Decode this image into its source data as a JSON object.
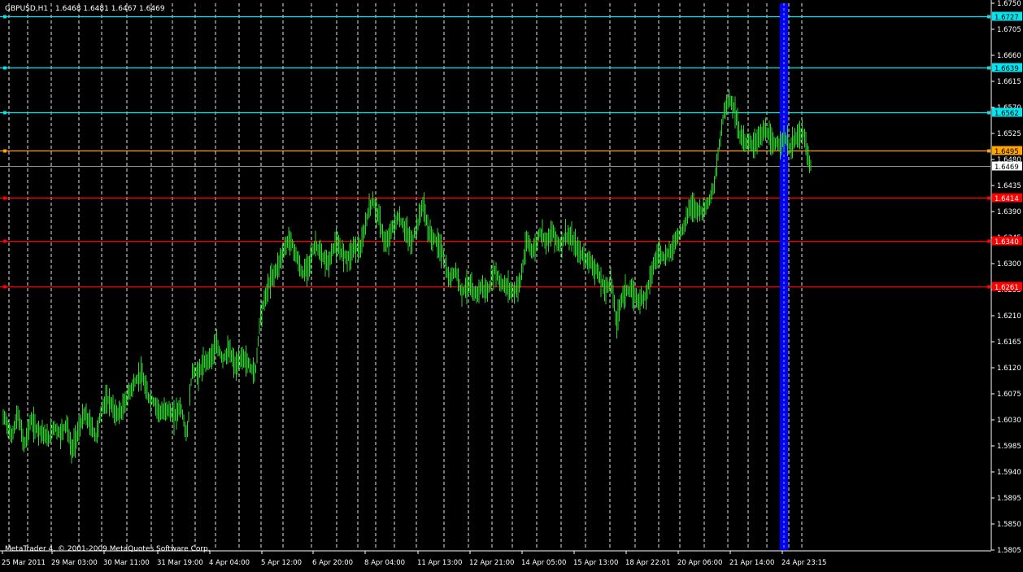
{
  "chart_data": {
    "type": "candlestick",
    "symbol_label": "GBPUSD,H1",
    "ohlc_label": "1.6468 1.6481 1.6467 1.6469",
    "copyright": "MetaTrader 4, © 2001-2009 MetaQuotes Software Corp.",
    "ylim": [
      1.5805,
      1.675
    ],
    "y_ticks": [
      "1.6750",
      "1.6705",
      "1.6660",
      "1.6615",
      "1.6570",
      "1.6525",
      "1.6480",
      "1.6435",
      "1.6390",
      "1.6345",
      "1.6300",
      "1.6255",
      "1.6210",
      "1.6165",
      "1.6120",
      "1.6075",
      "1.6030",
      "1.5985",
      "1.5940",
      "1.5895",
      "1.5850",
      "1.5805"
    ],
    "x_ticks": [
      "25 Mar 2011",
      "29 Mar 03:00",
      "30 Mar 11:00",
      "31 Mar 19:00",
      "4 Apr 04:00",
      "5 Apr 12:00",
      "6 Apr 20:00",
      "8 Apr 04:00",
      "11 Apr 13:00",
      "12 Apr 21:00",
      "14 Apr 05:00",
      "15 Apr 13:00",
      "18 Apr 22:01",
      "20 Apr 06:00",
      "21 Apr 14:00",
      "24 Apr 23:15"
    ],
    "horizontal_levels": [
      {
        "label": "1.6727",
        "value": 1.6727,
        "color": "#00e5ee",
        "tag_text_color": "#000000"
      },
      {
        "label": "1.6639",
        "value": 1.6639,
        "color": "#00e5ee",
        "tag_text_color": "#000000"
      },
      {
        "label": "1.6562",
        "value": 1.6562,
        "color": "#00e5ee",
        "tag_text_color": "#000000"
      },
      {
        "label": "1.6495",
        "value": 1.6495,
        "color": "#ffa500",
        "tag_text_color": "#000000"
      },
      {
        "label": "1.6414",
        "value": 1.6414,
        "color": "#ff0000",
        "tag_text_color": "#ffffff"
      },
      {
        "label": "1.6340",
        "value": 1.634,
        "color": "#ff0000",
        "tag_text_color": "#ffffff"
      },
      {
        "label": "1.6261",
        "value": 1.6261,
        "color": "#ff0000",
        "tag_text_color": "#ffffff"
      }
    ],
    "bid_line": {
      "label": "1.6469",
      "value": 1.6469,
      "color": "#c0c0c0"
    },
    "vertical_marker": {
      "color": "#0000ff",
      "position": "at 24 Apr 23:15"
    },
    "series_anchors": [
      [
        0,
        1.6025
      ],
      [
        6,
        1.6035
      ],
      [
        14,
        1.6
      ],
      [
        22,
        1.604
      ],
      [
        30,
        1.5985
      ],
      [
        38,
        1.603
      ],
      [
        44,
        1.6015
      ],
      [
        52,
        1.601
      ],
      [
        60,
        1.5995
      ],
      [
        66,
        1.602
      ],
      [
        74,
        1.6005
      ],
      [
        82,
        1.6025
      ],
      [
        88,
        1.5975
      ],
      [
        96,
        1.601
      ],
      [
        104,
        1.604
      ],
      [
        112,
        1.602
      ],
      [
        118,
        1.6
      ],
      [
        126,
        1.6055
      ],
      [
        134,
        1.6065
      ],
      [
        142,
        1.604
      ],
      [
        150,
        1.6045
      ],
      [
        158,
        1.6075
      ],
      [
        166,
        1.6095
      ],
      [
        174,
        1.611
      ],
      [
        182,
        1.607
      ],
      [
        190,
        1.606
      ],
      [
        198,
        1.604
      ],
      [
        206,
        1.605
      ],
      [
        214,
        1.6035
      ],
      [
        222,
        1.6055
      ],
      [
        230,
        1.6
      ],
      [
        236,
        1.6115
      ],
      [
        244,
        1.611
      ],
      [
        252,
        1.613
      ],
      [
        260,
        1.614
      ],
      [
        266,
        1.616
      ],
      [
        274,
        1.6135
      ],
      [
        282,
        1.615
      ],
      [
        290,
        1.612
      ],
      [
        298,
        1.614
      ],
      [
        306,
        1.6125
      ],
      [
        314,
        1.611
      ],
      [
        320,
        1.621
      ],
      [
        326,
        1.624
      ],
      [
        332,
        1.627
      ],
      [
        340,
        1.629
      ],
      [
        348,
        1.632
      ],
      [
        356,
        1.6345
      ],
      [
        364,
        1.6315
      ],
      [
        372,
        1.628
      ],
      [
        380,
        1.63
      ],
      [
        388,
        1.6335
      ],
      [
        396,
        1.631
      ],
      [
        404,
        1.63
      ],
      [
        412,
        1.6335
      ],
      [
        420,
        1.632
      ],
      [
        428,
        1.631
      ],
      [
        436,
        1.633
      ],
      [
        444,
        1.6325
      ],
      [
        452,
        1.6385
      ],
      [
        458,
        1.641
      ],
      [
        466,
        1.638
      ],
      [
        474,
        1.633
      ],
      [
        482,
        1.636
      ],
      [
        490,
        1.638
      ],
      [
        498,
        1.636
      ],
      [
        506,
        1.6335
      ],
      [
        514,
        1.637
      ],
      [
        520,
        1.6405
      ],
      [
        528,
        1.635
      ],
      [
        536,
        1.634
      ],
      [
        544,
        1.632
      ],
      [
        552,
        1.627
      ],
      [
        560,
        1.629
      ],
      [
        568,
        1.625
      ],
      [
        576,
        1.6265
      ],
      [
        584,
        1.6245
      ],
      [
        592,
        1.626
      ],
      [
        600,
        1.625
      ],
      [
        608,
        1.629
      ],
      [
        616,
        1.6265
      ],
      [
        624,
        1.626
      ],
      [
        632,
        1.625
      ],
      [
        640,
        1.627
      ],
      [
        648,
        1.634
      ],
      [
        656,
        1.632
      ],
      [
        664,
        1.6355
      ],
      [
        672,
        1.634
      ],
      [
        680,
        1.6355
      ],
      [
        688,
        1.633
      ],
      [
        696,
        1.635
      ],
      [
        704,
        1.634
      ],
      [
        712,
        1.632
      ],
      [
        720,
        1.631
      ],
      [
        728,
        1.63
      ],
      [
        736,
        1.628
      ],
      [
        744,
        1.6255
      ],
      [
        752,
        1.627
      ],
      [
        758,
        1.6195
      ],
      [
        764,
        1.624
      ],
      [
        770,
        1.6255
      ],
      [
        778,
        1.625
      ],
      [
        786,
        1.6235
      ],
      [
        794,
        1.6245
      ],
      [
        802,
        1.629
      ],
      [
        810,
        1.632
      ],
      [
        818,
        1.631
      ],
      [
        826,
        1.6325
      ],
      [
        834,
        1.635
      ],
      [
        842,
        1.6365
      ],
      [
        848,
        1.64
      ],
      [
        856,
        1.6395
      ],
      [
        864,
        1.639
      ],
      [
        872,
        1.641
      ],
      [
        878,
        1.643
      ],
      [
        884,
        1.65
      ],
      [
        890,
        1.656
      ],
      [
        896,
        1.6585
      ],
      [
        902,
        1.6575
      ],
      [
        910,
        1.652
      ],
      [
        918,
        1.651
      ],
      [
        926,
        1.6505
      ],
      [
        934,
        1.652
      ],
      [
        942,
        1.653
      ],
      [
        950,
        1.6505
      ],
      [
        958,
        1.651
      ],
      [
        966,
        1.6515
      ],
      [
        972,
        1.65
      ],
      [
        980,
        1.652
      ],
      [
        988,
        1.6525
      ],
      [
        994,
        1.648
      ],
      [
        997,
        1.6469
      ]
    ]
  }
}
